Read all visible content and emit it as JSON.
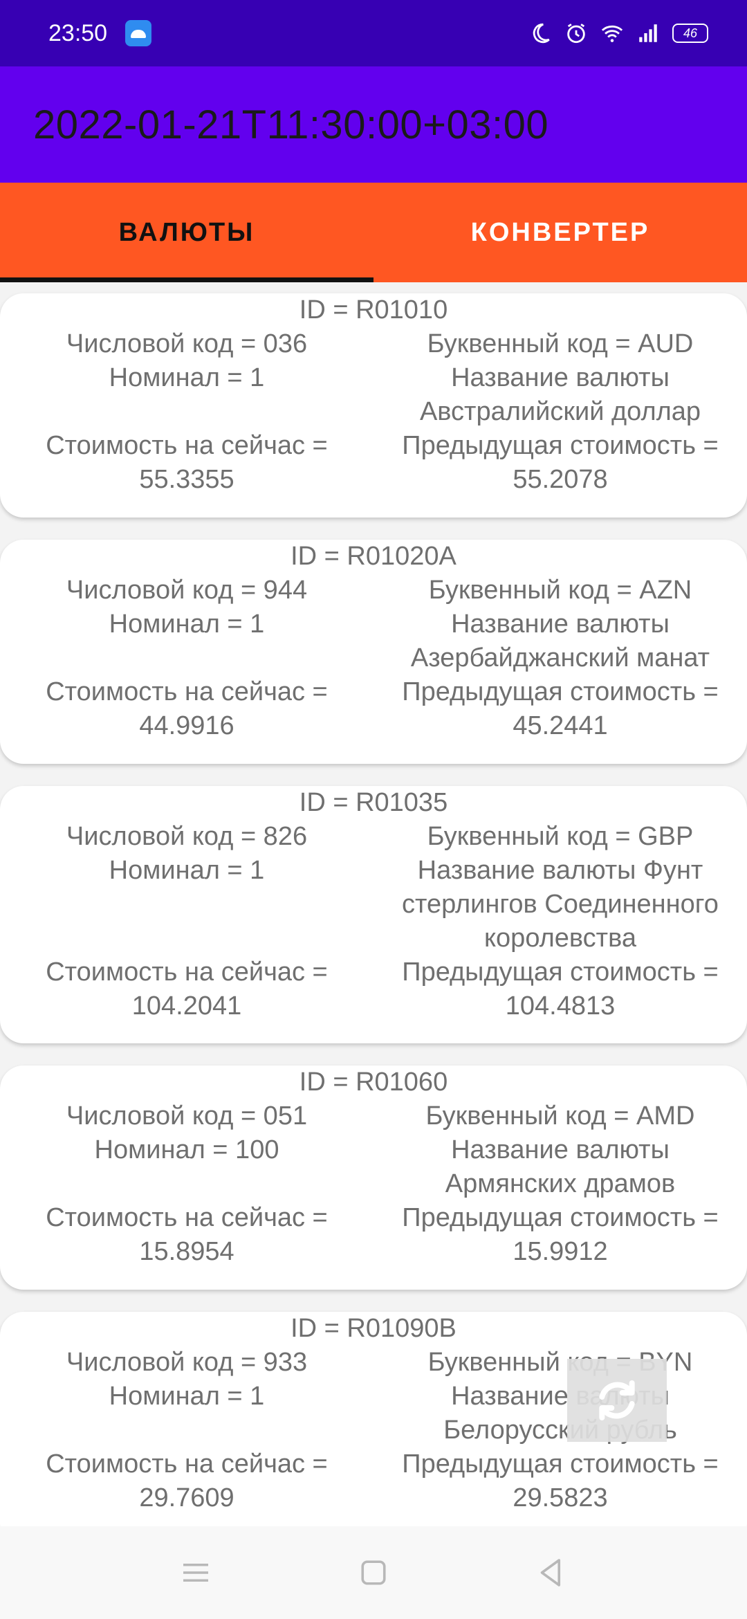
{
  "status_bar": {
    "time": "23:50",
    "battery": "46"
  },
  "app_bar": {
    "title": "2022-01-21T11:30:00+03:00"
  },
  "tabs": [
    {
      "label": "ВАЛЮТЫ",
      "active": true
    },
    {
      "label": "КОНВЕРТЕР",
      "active": false
    }
  ],
  "currencies": [
    {
      "id": "ID = R01010",
      "num_code": "Числовой код = 036",
      "char_code": "Буквенный код = AUD",
      "nominal": "Номинал = 1",
      "name_lines": [
        "Название валюты",
        "Австралийский доллар"
      ],
      "value_label": "Стоимость на сейчас =",
      "value": "55.3355",
      "previous_label": "Предыдущая стоимость =",
      "previous": "55.2078"
    },
    {
      "id": "ID = R01020A",
      "num_code": "Числовой код = 944",
      "char_code": "Буквенный код = AZN",
      "nominal": "Номинал = 1",
      "name_lines": [
        "Название валюты",
        "Азербайджанский манат"
      ],
      "value_label": "Стоимость на сейчас =",
      "value": "44.9916",
      "previous_label": "Предыдущая стоимость =",
      "previous": "45.2441"
    },
    {
      "id": "ID = R01035",
      "num_code": "Числовой код = 826",
      "char_code": "Буквенный код = GBP",
      "nominal": "Номинал = 1",
      "name_lines": [
        "Название валюты Фунт",
        "стерлингов Соединенного",
        "королевства"
      ],
      "value_label": "Стоимость на сейчас =",
      "value": "104.2041",
      "previous_label": "Предыдущая стоимость =",
      "previous": "104.4813"
    },
    {
      "id": "ID = R01060",
      "num_code": "Числовой код = 051",
      "char_code": "Буквенный код = AMD",
      "nominal": "Номинал = 100",
      "name_lines": [
        "Название валюты",
        "Армянских драмов"
      ],
      "value_label": "Стоимость на сейчас =",
      "value": "15.8954",
      "previous_label": "Предыдущая стоимость =",
      "previous": "15.9912"
    },
    {
      "id": "ID = R01090B",
      "num_code": "Числовой код = 933",
      "char_code": "Буквенный код = BYN",
      "nominal": "Номинал = 1",
      "name_lines": [
        "Название валюты",
        "Белорусский рубль"
      ],
      "value_label": "Стоимость на сейчас =",
      "value": "29.7609",
      "previous_label": "Предыдущая стоимость =",
      "previous": "29.5823"
    }
  ],
  "icons": {
    "refresh": "refresh-icon",
    "nav_menu": "menu-icon",
    "nav_home": "home-icon",
    "nav_back": "back-icon"
  },
  "colors": {
    "status_bar": "#3700b3",
    "app_bar": "#6200ee",
    "tabs": "#ff5722"
  }
}
